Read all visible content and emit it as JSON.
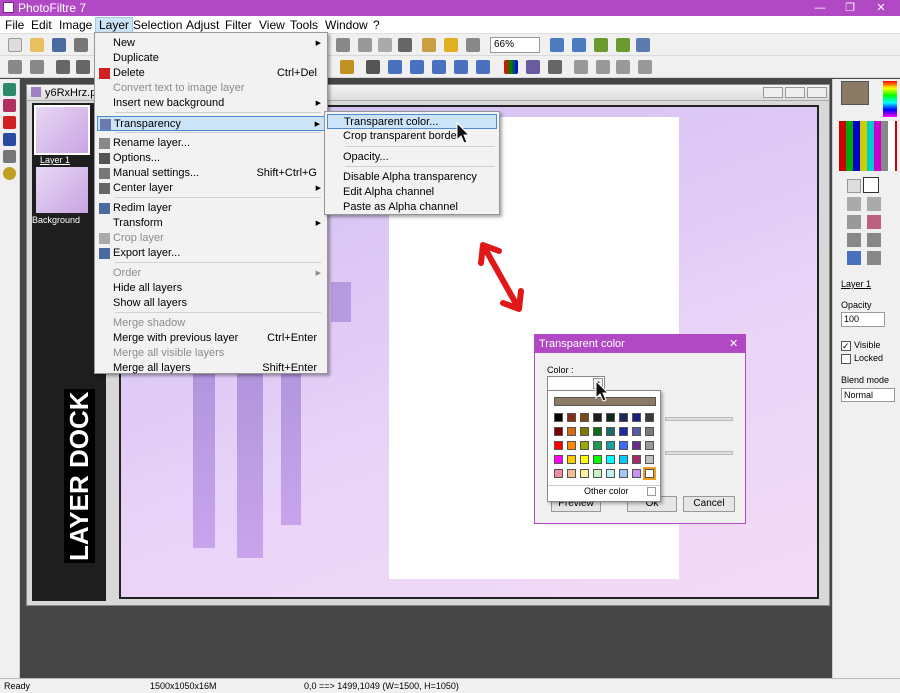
{
  "app": {
    "title": "PhotoFiltre 7",
    "window_buttons": [
      "—",
      "❐",
      "✕"
    ]
  },
  "menubar": [
    "File",
    "Edit",
    "Image",
    "Layer",
    "Selection",
    "Adjust",
    "Filter",
    "View",
    "Tools",
    "Window",
    "?"
  ],
  "toolbar": {
    "zoom": "66%"
  },
  "document": {
    "title": "y6RxHrz.pn"
  },
  "layers": {
    "layer1": "Layer 1",
    "background": "Background",
    "dock_text": "LAYER DOCK"
  },
  "layer_menu": {
    "items": [
      {
        "label": "New",
        "submenu": true
      },
      {
        "label": "Duplicate"
      },
      {
        "label": "Delete",
        "shortcut": "Ctrl+Del"
      },
      {
        "label": "Convert text to image layer",
        "disabled": true
      },
      {
        "label": "Insert new background",
        "submenu": true
      },
      {
        "label": "Transparency",
        "submenu": true,
        "highlighted": true
      },
      {
        "label": "Rename layer..."
      },
      {
        "label": "Options..."
      },
      {
        "label": "Manual settings...",
        "shortcut": "Shift+Ctrl+G"
      },
      {
        "label": "Center layer",
        "submenu": true
      },
      {
        "label": "Redim layer"
      },
      {
        "label": "Transform",
        "submenu": true
      },
      {
        "label": "Crop layer",
        "disabled": true
      },
      {
        "label": "Export layer..."
      },
      {
        "label": "Order",
        "submenu": true,
        "disabled": true
      },
      {
        "label": "Hide all layers"
      },
      {
        "label": "Show all layers"
      },
      {
        "label": "Merge shadow",
        "disabled": true
      },
      {
        "label": "Merge with previous layer",
        "shortcut": "Ctrl+Enter"
      },
      {
        "label": "Merge all visible layers",
        "disabled": true
      },
      {
        "label": "Merge all layers",
        "shortcut": "Shift+Enter"
      }
    ]
  },
  "transparency_menu": {
    "items": [
      {
        "label": "Transparent color...",
        "highlighted": true
      },
      {
        "label": "Crop transparent border"
      },
      {
        "label": "Opacity..."
      },
      {
        "label": "Disable Alpha transparency"
      },
      {
        "label": "Edit Alpha channel"
      },
      {
        "label": "Paste as Alpha channel"
      }
    ]
  },
  "dialog": {
    "title": "Transparent color",
    "close": "✕",
    "color_label": "Color :",
    "preview": "Preview",
    "ok": "Ok",
    "cancel": "Cancel",
    "other_color": "Other color"
  },
  "palette": {
    "top_color": "#8a7a66",
    "rows": [
      [
        "#000000",
        "#8b2c19",
        "#7a4a14",
        "#1e1e1e",
        "#0d2a1a",
        "#1b2a5a",
        "#1a1e80",
        "#3a3a3a"
      ],
      [
        "#7a0000",
        "#d86a12",
        "#7a7a00",
        "#0c6a16",
        "#1a6a6a",
        "#1a2aa0",
        "#5a5aa0",
        "#7a7a7a"
      ],
      [
        "#ff0000",
        "#ff8800",
        "#9aaa00",
        "#1a9a4a",
        "#1aa0a0",
        "#3a6aff",
        "#6a2a8a",
        "#9a9a9a"
      ],
      [
        "#ff00ff",
        "#ffcc00",
        "#ffff00",
        "#00ff00",
        "#00ffff",
        "#00ccff",
        "#a0306a",
        "#c0c0c0"
      ],
      [
        "#f08aa0",
        "#f0c090",
        "#f8f0a0",
        "#c8f0c0",
        "#c0f0f0",
        "#a0c8f8",
        "#c890f0",
        "#ffffff"
      ]
    ]
  },
  "right_panel": {
    "layer_name": "Layer 1",
    "opacity_label": "Opacity",
    "opacity_value": "100",
    "visible": "Visible",
    "locked": "Locked",
    "blend_label": "Blend mode",
    "blend_value": "Normal",
    "current_color": "#8a7a66"
  },
  "status": {
    "left": "Ready",
    "size": "1500x1050x16M",
    "coords": "0,0 ==> 1499,1049 (W=1500, H=1050)"
  }
}
